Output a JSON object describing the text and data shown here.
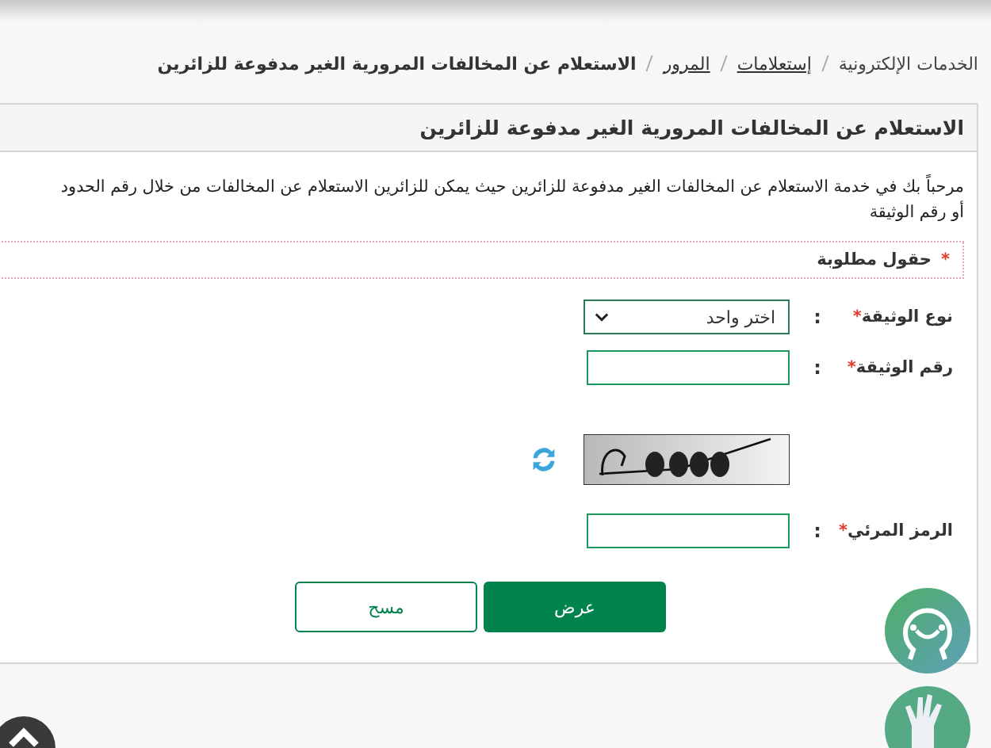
{
  "breadcrumb": [
    {
      "label": "الخدمات الإلكترونية",
      "link": false
    },
    {
      "label": "إستعلامات",
      "link": true
    },
    {
      "label": "المرور",
      "link": true
    },
    {
      "label": "الاستعلام عن المخالفات المرورية الغير مدفوعة للزائرين",
      "link": false
    }
  ],
  "panel": {
    "title": "الاستعلام عن المخالفات المرورية الغير مدفوعة للزائرين",
    "intro": "مرحباً بك في خدمة الاستعلام عن المخالفات الغير مدفوعة للزائرين حيث يمكن للزائرين الاستعلام عن المخالفات من خلال رقم الحدود\nأو رقم الوثيقة",
    "required_note": {
      "mark": "*",
      "text": "حقول مطلوبة"
    }
  },
  "form": [
    {
      "kind": "select",
      "label": "نوع الوثيقة",
      "required_mark": "*",
      "colon": ":",
      "value": "اختر واحد"
    },
    {
      "kind": "input",
      "label": "رقم الوثيقة",
      "required_mark": "*",
      "colon": ":"
    },
    {
      "kind": "captcha"
    },
    {
      "kind": "input",
      "label": "الرمز المرئي",
      "required_mark": "*",
      "colon": ":"
    }
  ],
  "buttons": [
    {
      "label": "عرض",
      "kind": "primary"
    },
    {
      "label": "مسح",
      "kind": "secondary"
    }
  ]
}
